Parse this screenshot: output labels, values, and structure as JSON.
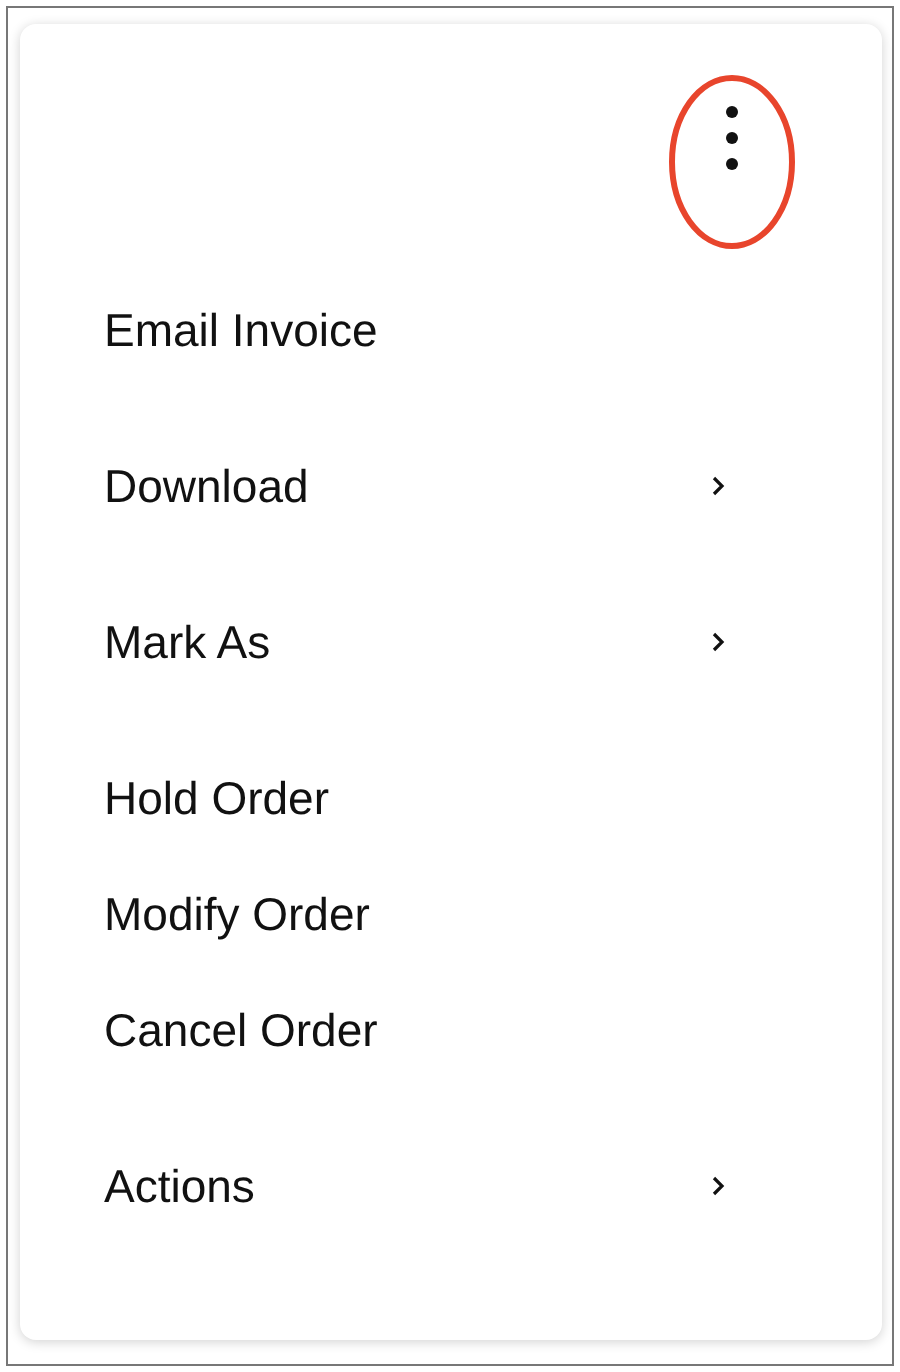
{
  "sections": [
    [
      {
        "label": "Email Invoice",
        "has_submenu": false
      }
    ],
    [
      {
        "label": "Download",
        "has_submenu": true
      }
    ],
    [
      {
        "label": "Mark As",
        "has_submenu": true
      }
    ],
    [
      {
        "label": "Hold Order",
        "has_submenu": false
      },
      {
        "label": "Modify Order",
        "has_submenu": false
      },
      {
        "label": "Cancel Order",
        "has_submenu": false
      }
    ],
    [
      {
        "label": "Actions",
        "has_submenu": true
      }
    ]
  ]
}
